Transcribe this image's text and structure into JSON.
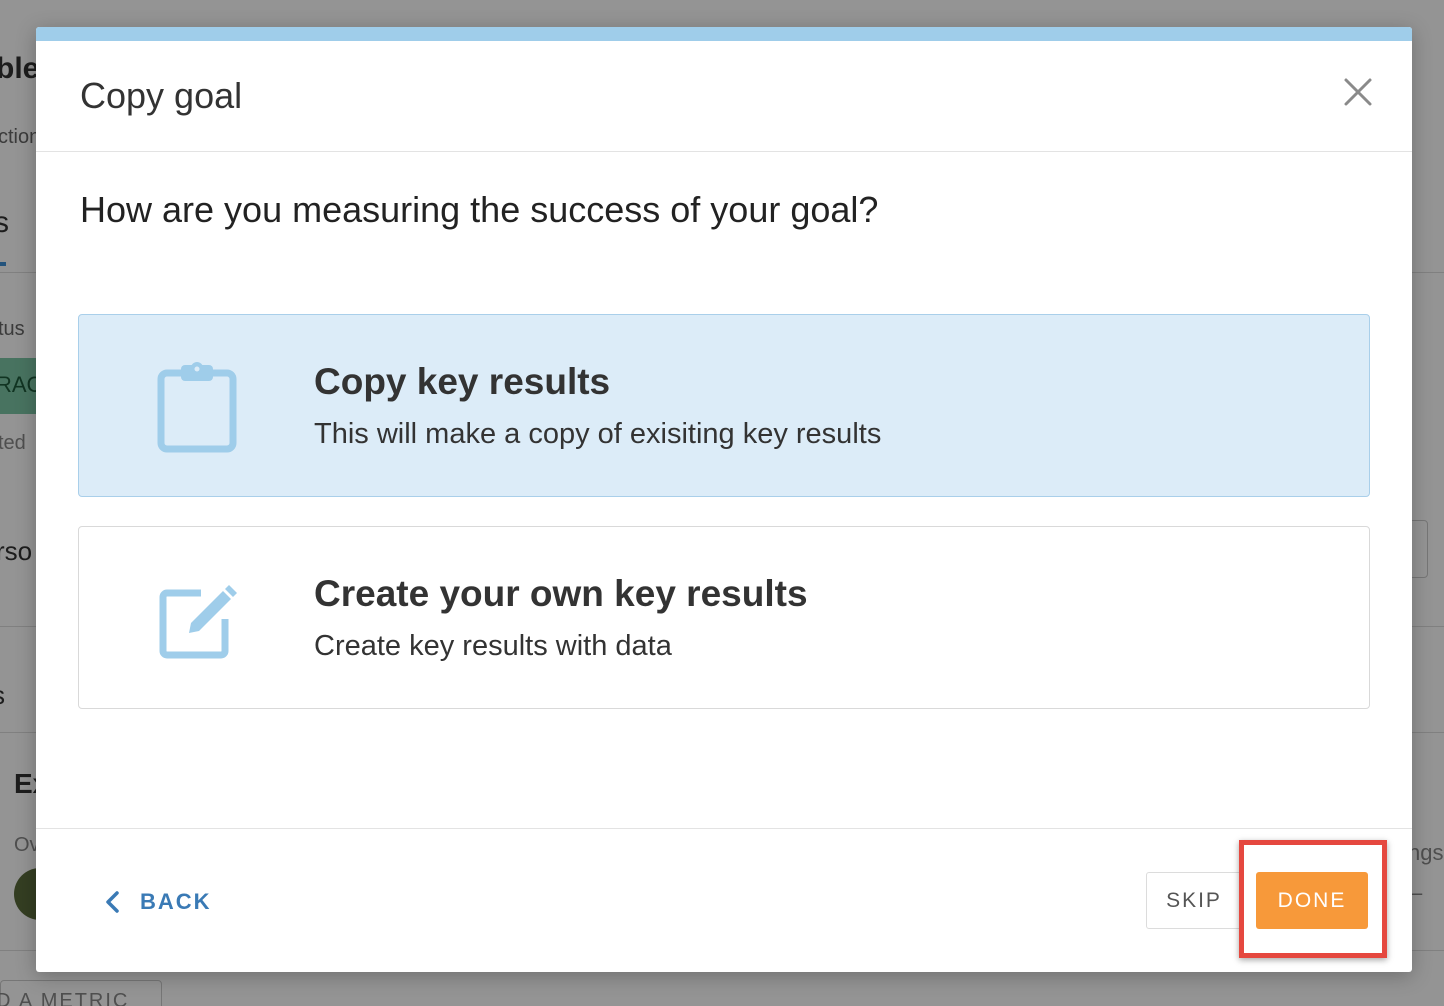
{
  "background": {
    "texts": [
      "ble",
      "ction",
      "s",
      "tus",
      "RAC",
      "ted",
      "rso",
      "s",
      "Ex",
      "Ov",
      "D A METRIC",
      "ngs",
      "–"
    ]
  },
  "modal": {
    "title": "Copy goal",
    "close_icon": "close-icon",
    "question": "How are you measuring the success of your goal?",
    "options": [
      {
        "icon": "clipboard-icon",
        "title": "Copy key results",
        "description": "This will make a copy of exisiting key results",
        "selected": true
      },
      {
        "icon": "edit-icon",
        "title": "Create your own key results",
        "description": "Create key results with data",
        "selected": false
      }
    ],
    "footer": {
      "back_label": "BACK",
      "skip_label": "SKIP",
      "done_label": "DONE"
    }
  },
  "colors": {
    "accent_top_bar": "#9fcdea",
    "selected_option_bg": "#dcecf8",
    "icon_blue": "#9fcdea",
    "done_orange": "#f7993a",
    "back_blue": "#3a7ab5",
    "highlight_red": "#e5483f"
  }
}
